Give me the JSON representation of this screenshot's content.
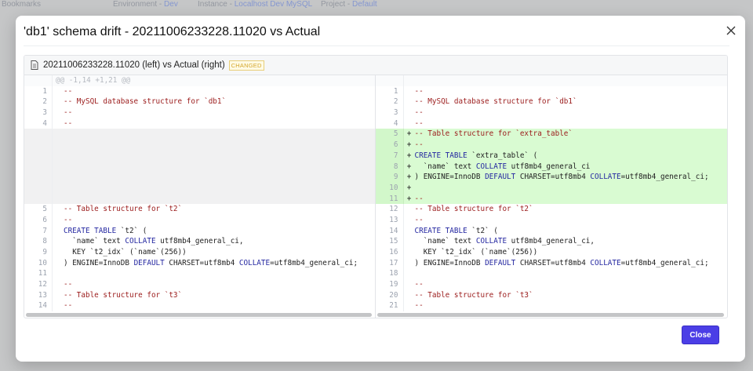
{
  "background": {
    "bookmarks": "Bookmarks",
    "environment_label": "Environment - ",
    "environment_value": "Dev",
    "instance_label": "Instance - ",
    "instance_value": "Localhost Dev MySQL",
    "project_label": "Project - ",
    "project_value": "Default"
  },
  "modal": {
    "title": "'db1' schema drift - 20211006233228.11020 vs Actual",
    "close_icon": "x-icon",
    "close_button": "Close",
    "accent_color": "#4b3ee6"
  },
  "diff": {
    "file_icon": "file-icon",
    "file_header": "20211006233228.11020 (left) vs Actual (right)",
    "badge": "CHANGED",
    "hunk": "@@ -1,14 +1,21 @@",
    "left": [
      {
        "n": "1",
        "s": [
          {
            "t": "--",
            "c": "c"
          }
        ]
      },
      {
        "n": "2",
        "s": [
          {
            "t": "-- MySQL database structure for `db1`",
            "c": "c"
          }
        ]
      },
      {
        "n": "3",
        "s": [
          {
            "t": "--",
            "c": "c"
          }
        ]
      },
      {
        "n": "4",
        "s": [
          {
            "t": "--",
            "c": "c"
          }
        ]
      },
      {
        "empty": true
      },
      {
        "empty": true
      },
      {
        "empty": true
      },
      {
        "empty": true
      },
      {
        "empty": true
      },
      {
        "empty": true
      },
      {
        "empty": true
      },
      {
        "n": "5",
        "s": [
          {
            "t": "-- Table structure for `t2`",
            "c": "c"
          }
        ]
      },
      {
        "n": "6",
        "s": [
          {
            "t": "--",
            "c": "c"
          }
        ]
      },
      {
        "n": "7",
        "s": [
          {
            "t": "CREATE TABLE",
            "c": "k"
          },
          {
            "t": " `t2` (",
            "c": "p"
          }
        ]
      },
      {
        "n": "8",
        "s": [
          {
            "t": "  `name` text ",
            "c": "p"
          },
          {
            "t": "COLLATE",
            "c": "k"
          },
          {
            "t": " utf8mb4_general_ci,",
            "c": "p"
          }
        ]
      },
      {
        "n": "9",
        "s": [
          {
            "t": "  KEY `t2_idx` (`name`(256))",
            "c": "p"
          }
        ]
      },
      {
        "n": "10",
        "s": [
          {
            "t": ") ENGINE=InnoDB ",
            "c": "p"
          },
          {
            "t": "DEFAULT",
            "c": "k"
          },
          {
            "t": " CHARSET=utf8mb4 ",
            "c": "p"
          },
          {
            "t": "COLLATE",
            "c": "k"
          },
          {
            "t": "=utf8mb4_general_ci;",
            "c": "p"
          }
        ]
      },
      {
        "n": "11",
        "s": []
      },
      {
        "n": "12",
        "s": [
          {
            "t": "--",
            "c": "c"
          }
        ]
      },
      {
        "n": "13",
        "s": [
          {
            "t": "-- Table structure for `t3`",
            "c": "c"
          }
        ]
      },
      {
        "n": "14",
        "s": [
          {
            "t": "--",
            "c": "c"
          }
        ]
      }
    ],
    "right": [
      {
        "n": "1",
        "s": [
          {
            "t": "--",
            "c": "c"
          }
        ]
      },
      {
        "n": "2",
        "s": [
          {
            "t": "-- MySQL database structure for `db1`",
            "c": "c"
          }
        ]
      },
      {
        "n": "3",
        "s": [
          {
            "t": "--",
            "c": "c"
          }
        ]
      },
      {
        "n": "4",
        "s": [
          {
            "t": "--",
            "c": "c"
          }
        ]
      },
      {
        "n": "5",
        "add": true,
        "s": [
          {
            "t": "-- Table structure for `extra_table`",
            "c": "c"
          }
        ]
      },
      {
        "n": "6",
        "add": true,
        "s": [
          {
            "t": "--",
            "c": "c"
          }
        ]
      },
      {
        "n": "7",
        "add": true,
        "s": [
          {
            "t": "CREATE TABLE",
            "c": "k"
          },
          {
            "t": " `extra_table` (",
            "c": "p"
          }
        ]
      },
      {
        "n": "8",
        "add": true,
        "s": [
          {
            "t": "  `name` text ",
            "c": "p"
          },
          {
            "t": "COLLATE",
            "c": "k"
          },
          {
            "t": " utf8mb4_general_ci",
            "c": "p"
          }
        ]
      },
      {
        "n": "9",
        "add": true,
        "s": [
          {
            "t": ") ENGINE=InnoDB ",
            "c": "p"
          },
          {
            "t": "DEFAULT",
            "c": "k"
          },
          {
            "t": " CHARSET=utf8mb4 ",
            "c": "p"
          },
          {
            "t": "COLLATE",
            "c": "k"
          },
          {
            "t": "=utf8mb4_general_ci;",
            "c": "p"
          }
        ]
      },
      {
        "n": "10",
        "add": true,
        "s": []
      },
      {
        "n": "11",
        "add": true,
        "s": [
          {
            "t": "--",
            "c": "c"
          }
        ]
      },
      {
        "n": "12",
        "s": [
          {
            "t": "-- Table structure for `t2`",
            "c": "c"
          }
        ]
      },
      {
        "n": "13",
        "s": [
          {
            "t": "--",
            "c": "c"
          }
        ]
      },
      {
        "n": "14",
        "s": [
          {
            "t": "CREATE TABLE",
            "c": "k"
          },
          {
            "t": " `t2` (",
            "c": "p"
          }
        ]
      },
      {
        "n": "15",
        "s": [
          {
            "t": "  `name` text ",
            "c": "p"
          },
          {
            "t": "COLLATE",
            "c": "k"
          },
          {
            "t": " utf8mb4_general_ci,",
            "c": "p"
          }
        ]
      },
      {
        "n": "16",
        "s": [
          {
            "t": "  KEY `t2_idx` (`name`(256))",
            "c": "p"
          }
        ]
      },
      {
        "n": "17",
        "s": [
          {
            "t": ") ENGINE=InnoDB ",
            "c": "p"
          },
          {
            "t": "DEFAULT",
            "c": "k"
          },
          {
            "t": " CHARSET=utf8mb4 ",
            "c": "p"
          },
          {
            "t": "COLLATE",
            "c": "k"
          },
          {
            "t": "=utf8mb4_general_ci;",
            "c": "p"
          }
        ]
      },
      {
        "n": "18",
        "s": []
      },
      {
        "n": "19",
        "s": [
          {
            "t": "--",
            "c": "c"
          }
        ]
      },
      {
        "n": "20",
        "s": [
          {
            "t": "-- Table structure for `t3`",
            "c": "c"
          }
        ]
      },
      {
        "n": "21",
        "s": [
          {
            "t": "--",
            "c": "c"
          }
        ]
      }
    ],
    "add_mark": "+"
  }
}
